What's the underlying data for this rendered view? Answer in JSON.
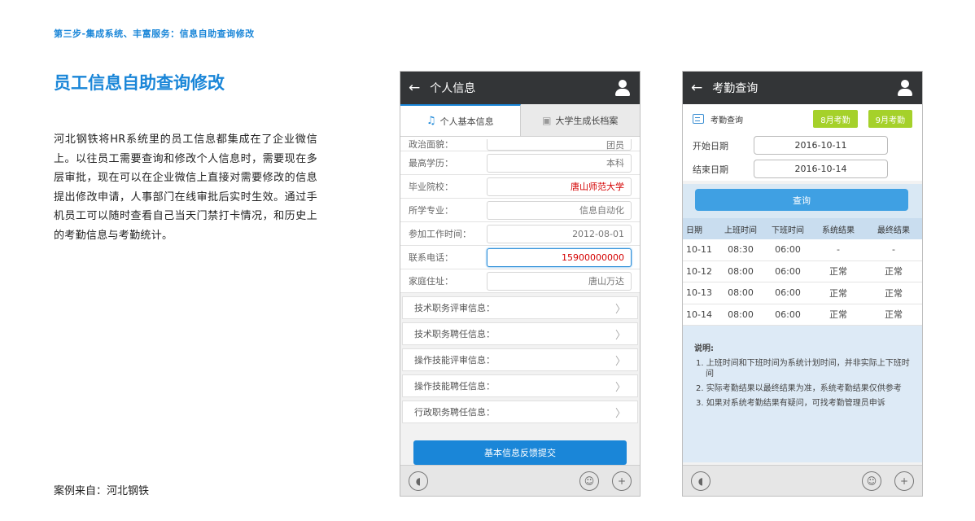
{
  "header": {
    "breadcrumb": "第三步-集成系统、丰富服务：信息自助查询修改",
    "title": "员工信息自助查询修改",
    "description": "河北钢铁将HR系统里的员工信息都集成在了企业微信上。以往员工需要查询和修改个人信息时，需要现在多层审批，现在可以在企业微信上直接对需要修改的信息提出修改申请，人事部门在线审批后实时生效。通过手机员工可以随时查看自己当天门禁打卡情况，和历史上的考勤信息与考勤统计。",
    "source": "案例来自：河北钢铁"
  },
  "phone1": {
    "title": "个人信息",
    "tabs": [
      "个人基本信息",
      "大学生成长档案"
    ],
    "fields": [
      {
        "label": "政治面貌：",
        "value": "团员"
      },
      {
        "label": "最高学历：",
        "value": "本科"
      },
      {
        "label": "毕业院校：",
        "value": "唐山师范大学"
      },
      {
        "label": "所学专业：",
        "value": "信息自动化"
      },
      {
        "label": "参加工作时间：",
        "value": "2012-08-01"
      },
      {
        "label": "联系电话：",
        "value": "15900000000"
      },
      {
        "label": "家庭住址：",
        "value": "唐山万达"
      }
    ],
    "links": [
      "技术职务评审信息：",
      "技术职务聘任信息：",
      "操作技能评审信息：",
      "操作技能聘任信息：",
      "行政职务聘任信息："
    ],
    "submit_label": "基本信息反馈提交",
    "accent": "#1a86d8"
  },
  "phone2": {
    "title": "考勤查询",
    "section_label": "考勤查询",
    "month_buttons": [
      "8月考勤",
      "9月考勤"
    ],
    "start_label": "开始日期",
    "start_value": "2016-10-11",
    "end_label": "结束日期",
    "end_value": "2016-10-14",
    "query_label": "查询",
    "table": {
      "headers": [
        "日期",
        "上班时间",
        "下班时间",
        "系统结果",
        "最终结果"
      ],
      "rows": [
        [
          "10-11",
          "08:30",
          "06:00",
          "-",
          "-"
        ],
        [
          "10-12",
          "08:00",
          "06:00",
          "正常",
          "正常"
        ],
        [
          "10-13",
          "08:00",
          "06:00",
          "正常",
          "正常"
        ],
        [
          "10-14",
          "08:00",
          "06:00",
          "正常",
          "正常"
        ]
      ]
    },
    "notes_title": "说明:",
    "notes": [
      "1. 上班时间和下班时间为系统计划时间，并非实际上下班时间",
      "2. 实际考勤结果以最终结果为准，系统考勤结果仅供参考",
      "3. 如果对系统考勤结果有疑问，可找考勤管理员申诉"
    ],
    "green": "#a5d12a"
  }
}
